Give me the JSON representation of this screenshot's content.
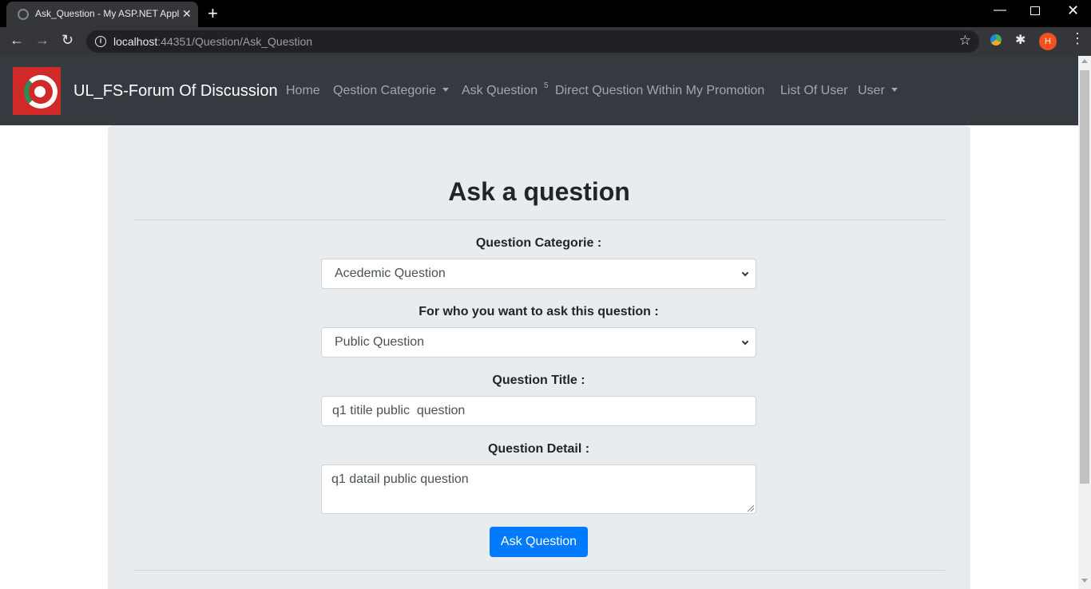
{
  "browser": {
    "tab_title": "Ask_Question - My ASP.NET Application",
    "url_host": "localhost",
    "url_rest": ":44351/Question/Ask_Question",
    "profile_initial": "H"
  },
  "navbar": {
    "brand": "UL_FS-Forum Of Discussion",
    "links": [
      "Home",
      "Qestion Categorie",
      "Ask Question",
      "Direct Question Within My Promotion",
      "List Of User",
      "User"
    ],
    "badge": "5"
  },
  "form": {
    "heading": "Ask a question",
    "category_label": "Question Categorie :",
    "category_value": "Acedemic Question",
    "audience_label": "For who you want to ask this question :",
    "audience_value": "Public Question",
    "title_label": "Question Title :",
    "title_value": "q1 titile public  question",
    "detail_label": "Question Detail :",
    "detail_value": "q1 datail public question",
    "submit_label": "Ask Question"
  },
  "colors": {
    "navbar_bg": "#343a40",
    "jumbotron_bg": "#e9ecef",
    "primary": "#007bff",
    "logo_red": "#cf2a27"
  }
}
